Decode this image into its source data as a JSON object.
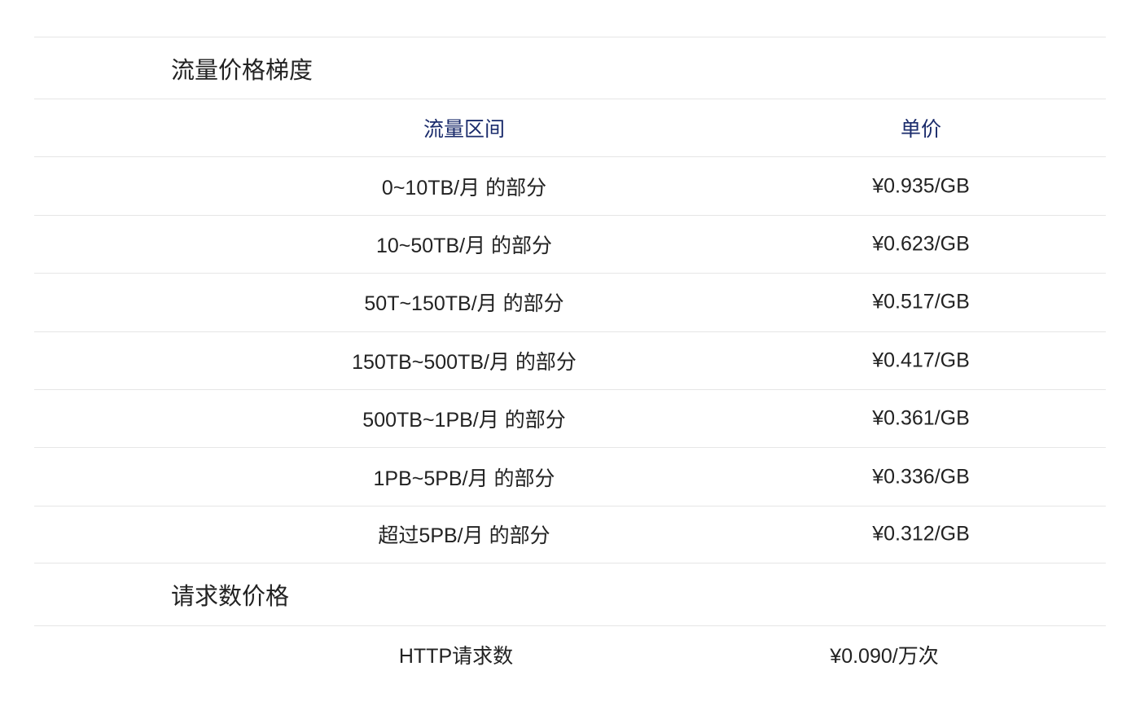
{
  "traffic_section": {
    "title": "流量价格梯度",
    "headers": {
      "range": "流量区间",
      "price": "单价"
    },
    "rows": [
      {
        "range": "0~10TB/月 的部分",
        "price": "¥0.935/GB"
      },
      {
        "range": "10~50TB/月 的部分",
        "price": "¥0.623/GB"
      },
      {
        "range": "50T~150TB/月 的部分",
        "price": "¥0.517/GB"
      },
      {
        "range": "150TB~500TB/月 的部分",
        "price": "¥0.417/GB"
      },
      {
        "range": "500TB~1PB/月 的部分",
        "price": "¥0.361/GB"
      },
      {
        "range": "1PB~5PB/月 的部分",
        "price": "¥0.336/GB"
      },
      {
        "range": "超过5PB/月 的部分",
        "price": "¥0.312/GB"
      }
    ]
  },
  "request_section": {
    "title": "请求数价格",
    "rows": [
      {
        "item": "HTTP请求数",
        "price": "¥0.090/万次"
      }
    ]
  }
}
